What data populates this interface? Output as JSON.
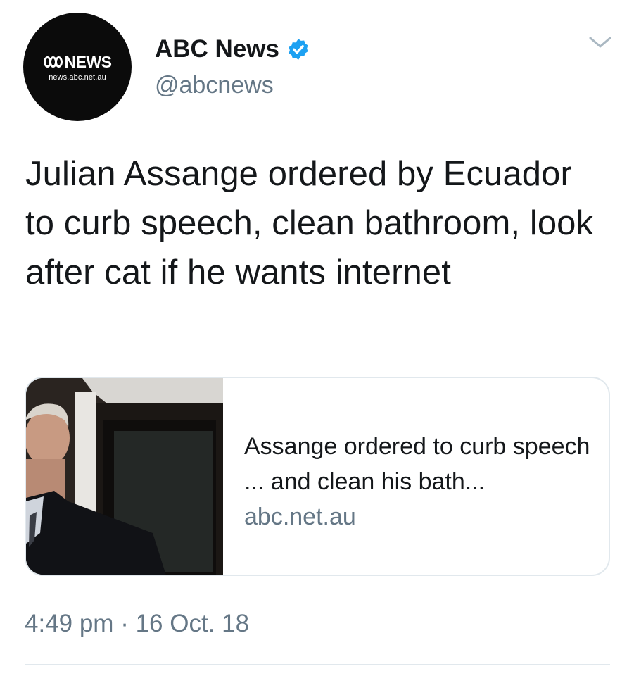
{
  "author": {
    "avatar_logo_text": "NEWS",
    "avatar_logo_url": "news.abc.net.au",
    "display_name": "ABC News",
    "handle": "@abcnews",
    "verified": true
  },
  "icons": {
    "verified": "verified-badge-icon",
    "menu": "chevron-down-icon"
  },
  "colors": {
    "verified_blue": "#1da1f2",
    "secondary_text": "#657786",
    "border": "#e1e8ed"
  },
  "tweet": {
    "text": "Julian Assange ordered by Ecuador to curb speech, clean bathroom, look after cat if he wants internet",
    "timestamp": "4:49 pm · 16 Oct. 18"
  },
  "card": {
    "title": "Assange ordered to curb speech ... and clean his bath...",
    "domain": "abc.net.au"
  }
}
